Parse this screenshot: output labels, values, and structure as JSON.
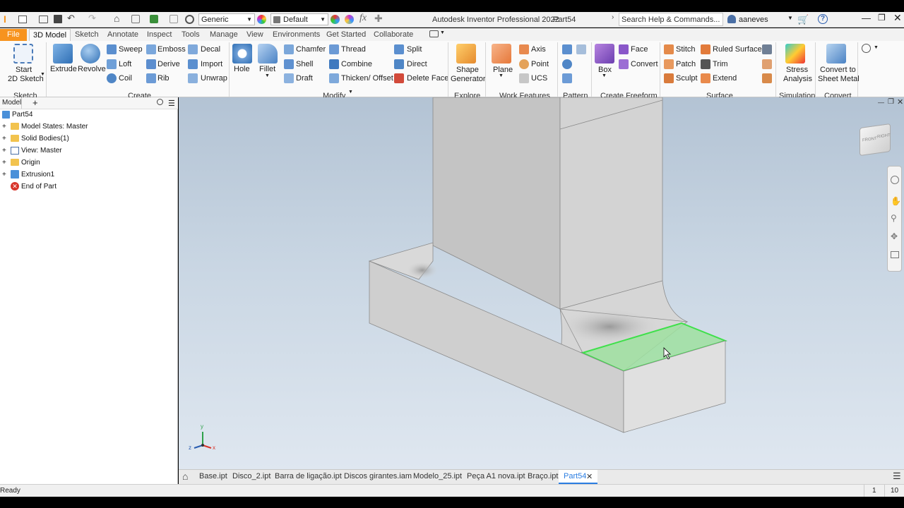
{
  "app": {
    "title": "Autodesk Inventor Professional 2022",
    "document": "Part54",
    "search_placeholder": "Search Help & Commands...",
    "user": "aaneves",
    "appearance": "Generic",
    "material": "Default"
  },
  "ribbon_tabs": [
    "File",
    "3D Model",
    "Sketch",
    "Annotate",
    "Inspect",
    "Tools",
    "Manage",
    "View",
    "Environments",
    "Get Started",
    "Collaborate"
  ],
  "sketch": {
    "start_line1": "Start",
    "start_line2": "2D Sketch",
    "panel": "Sketch"
  },
  "create": {
    "extrude": "Extrude",
    "revolve": "Revolve",
    "sweep": "Sweep",
    "emboss": "Emboss",
    "decal": "Decal",
    "loft": "Loft",
    "derive": "Derive",
    "import": "Import",
    "coil": "Coil",
    "rib": "Rib",
    "unwrap": "Unwrap",
    "panel": "Create"
  },
  "modify": {
    "hole": "Hole",
    "fillet": "Fillet",
    "chamfer": "Chamfer",
    "thread": "Thread",
    "split": "Split",
    "shell": "Shell",
    "combine": "Combine",
    "direct": "Direct",
    "draft": "Draft",
    "thicken": "Thicken/ Offset",
    "delete_face": "Delete Face",
    "panel": "Modify"
  },
  "explore": {
    "shape1": "Shape",
    "shape2": "Generator",
    "panel": "Explore"
  },
  "work": {
    "plane": "Plane",
    "axis": "Axis",
    "point": "Point",
    "ucs": "UCS",
    "panel": "Work Features"
  },
  "pattern": {
    "panel": "Pattern"
  },
  "freeform": {
    "box": "Box",
    "face": "Face",
    "convert": "Convert",
    "panel": "Create Freeform"
  },
  "surface": {
    "stitch": "Stitch",
    "ruled": "Ruled Surface",
    "patch": "Patch",
    "trim": "Trim",
    "sculpt": "Sculpt",
    "extend": "Extend",
    "panel": "Surface"
  },
  "simulation": {
    "l1": "Stress",
    "l2": "Analysis",
    "panel": "Simulation"
  },
  "convert": {
    "l1": "Convert to",
    "l2": "Sheet Metal",
    "panel": "Convert"
  },
  "browser": {
    "tab": "Model",
    "plus": "+",
    "root": "Part54",
    "items": [
      "Model States: Master",
      "Solid Bodies(1)",
      "View: Master",
      "Origin",
      "Extrusion1",
      "End of Part"
    ]
  },
  "doc_tabs": [
    "Base.ipt",
    "Disco_2.ipt",
    "Barra de ligação.ipt",
    "Discos girantes.iam",
    "Modelo_25.ipt",
    "Peça A1 nova.ipt",
    "Braço.ipt",
    "Part54"
  ],
  "status": {
    "text": "Ready",
    "n1": "1",
    "n2": "10"
  },
  "viewcube": {
    "front": "FRONT",
    "right": "RIGHT"
  },
  "triad": {
    "x": "x",
    "y": "y",
    "z": "z"
  }
}
